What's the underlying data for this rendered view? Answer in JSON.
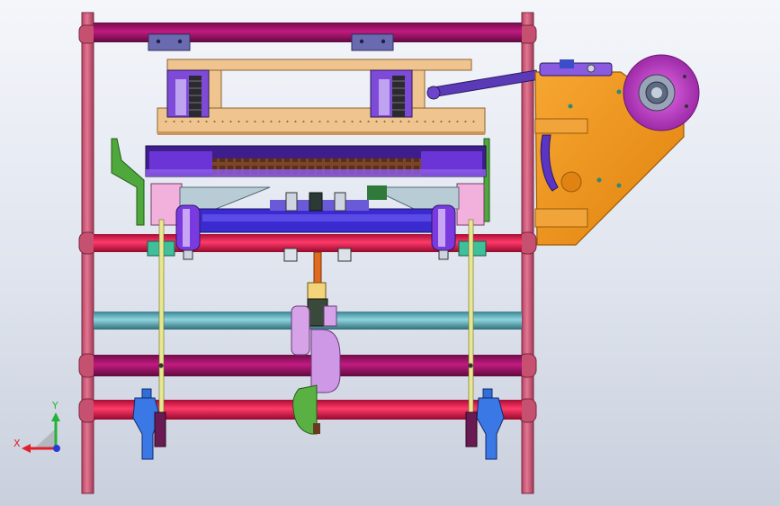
{
  "viewport": {
    "triad": {
      "x_label": "X",
      "y_label": "Y"
    }
  },
  "palette": {
    "frame": "#d65d7a",
    "frame_dark": "#9b3a52",
    "rail_magenta": "#a0166b",
    "rail_red": "#e8194e",
    "rail_teal": "#5fb4c0",
    "wood": "#efc48e",
    "wood_dark": "#b98c55",
    "violet": "#6f2de0",
    "violet_light": "#a26cf2",
    "lavender": "#cfa3e8",
    "orange": "#f0961b",
    "orange_dark": "#b96a10",
    "green": "#4fa83c",
    "blue": "#2f6fd8",
    "pink_light": "#f5b8de",
    "brown": "#6b3b22",
    "axis_x": "#e0202a",
    "axis_y": "#23b33a",
    "axis_z": "#2a39d6"
  }
}
